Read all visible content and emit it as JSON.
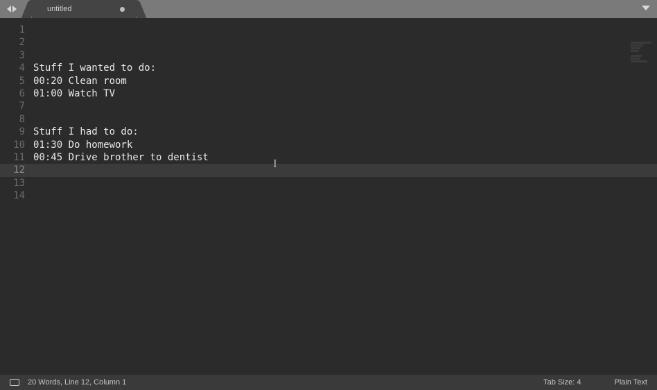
{
  "tab": {
    "title": "untitled",
    "dirty": true
  },
  "lines": [
    "",
    "",
    "",
    "Stuff I wanted to do:",
    "00:20 Clean room",
    "01:00 Watch TV",
    "",
    "",
    "Stuff I had to do:",
    "01:30 Do homework",
    "00:45 Drive brother to dentist",
    "",
    "",
    ""
  ],
  "cursor_line": 12,
  "status": {
    "words_line_col": "20 Words, Line 12, Column 1",
    "tab_size": "Tab Size: 4",
    "syntax": "Plain Text"
  }
}
